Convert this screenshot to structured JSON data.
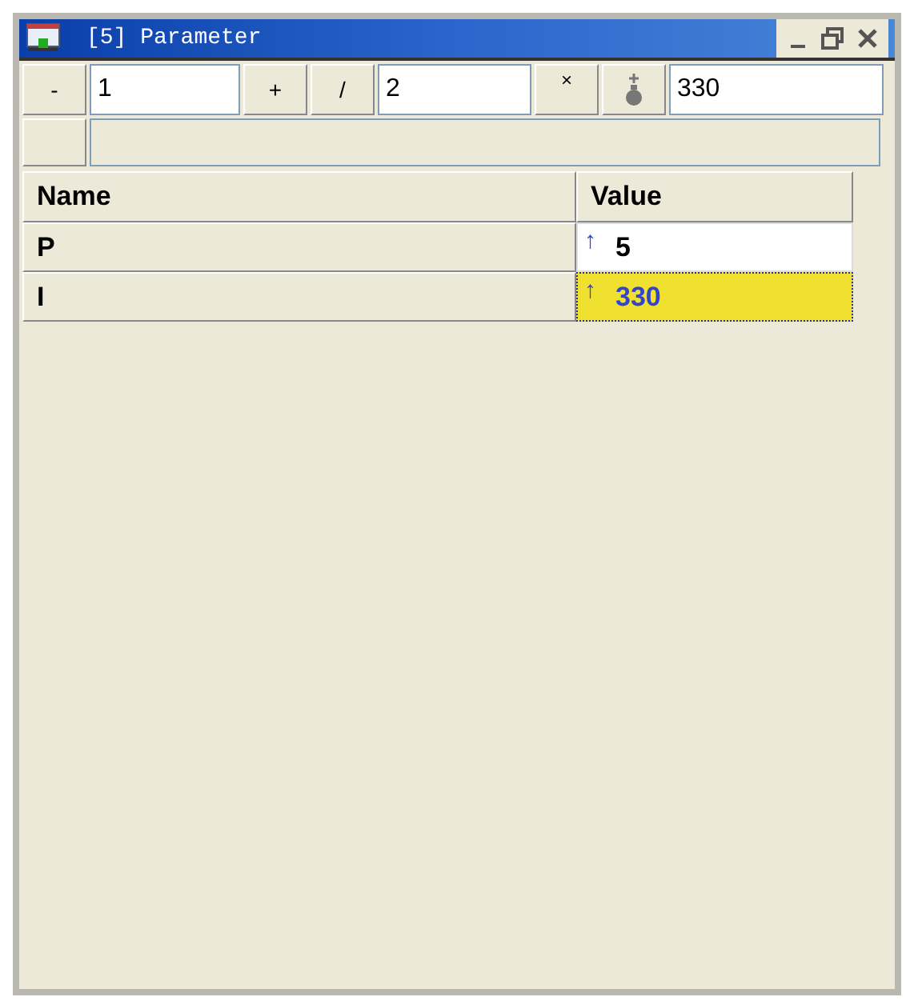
{
  "window": {
    "title": "[5] Parameter"
  },
  "toolbar": {
    "minus_label": "-",
    "field_1": "1",
    "plus_label": "+",
    "divide_label": "/",
    "field_2": "2",
    "multiply_label": "×",
    "field_3": "330"
  },
  "table": {
    "columns": [
      "Name",
      "Value"
    ],
    "rows": [
      {
        "name": "P",
        "arrow": "↑",
        "value": "5",
        "selected": false
      },
      {
        "name": "I",
        "arrow": "↑",
        "value": "330",
        "selected": true
      }
    ]
  }
}
